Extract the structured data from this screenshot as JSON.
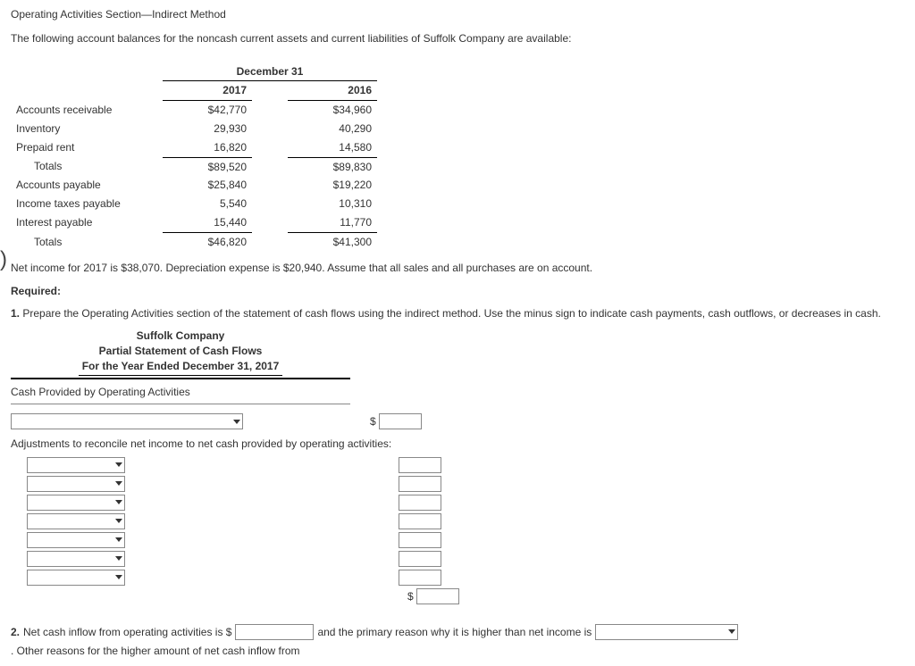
{
  "title": "Operating Activities Section—Indirect Method",
  "intro": "The following account balances for the noncash current assets and current liabilities of Suffolk Company are available:",
  "balances": {
    "date_header": "December 31",
    "years": [
      "2017",
      "2016"
    ],
    "rows": [
      {
        "label": "Accounts receivable",
        "y2017": "$42,770",
        "y2016": "$34,960"
      },
      {
        "label": "Inventory",
        "y2017": "29,930",
        "y2016": "40,290"
      },
      {
        "label": "Prepaid rent",
        "y2017": "16,820",
        "y2016": "14,580",
        "underline": true
      },
      {
        "label": "Totals",
        "y2017": "$89,520",
        "y2016": "$89,830",
        "indent": true
      },
      {
        "label": "Accounts payable",
        "y2017": "$25,840",
        "y2016": "$19,220"
      },
      {
        "label": "Income taxes payable",
        "y2017": "5,540",
        "y2016": "10,310"
      },
      {
        "label": "Interest payable",
        "y2017": "15,440",
        "y2016": "11,770",
        "underline": true
      },
      {
        "label": "Totals",
        "y2017": "$46,820",
        "y2016": "$41,300",
        "indent": true
      }
    ]
  },
  "net_income_line": "Net income for 2017 is $38,070. Depreciation expense is $20,940. Assume that all sales and all purchases are on account.",
  "required_label": "Required:",
  "q1": {
    "num": "1.",
    "text": "Prepare the Operating Activities section of the statement of cash flows using the indirect method. Use the minus sign to indicate cash payments, cash outflows, or decreases in cash."
  },
  "stmt": {
    "company": "Suffolk Company",
    "title": "Partial Statement of Cash Flows",
    "period": "For the Year Ended December 31, 2017"
  },
  "section_head": "Cash Provided by Operating Activities",
  "adj_label": "Adjustments to reconcile net income to net cash provided by operating activities:",
  "dollar": "$",
  "q2": {
    "num": "2.",
    "t1": "Net cash inflow from operating activities is $",
    "t2": "and the primary reason why it is higher than net income is",
    "t3": ". Other reasons for the higher amount of net cash inflow from"
  }
}
